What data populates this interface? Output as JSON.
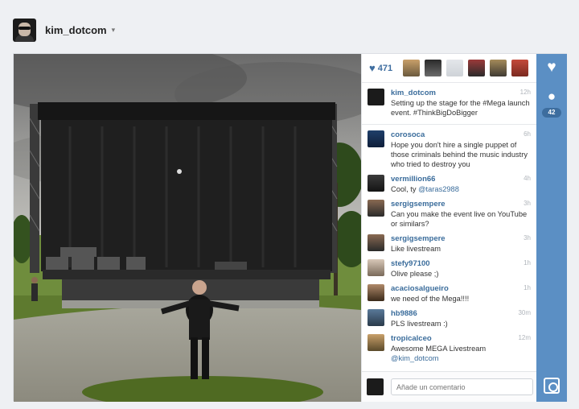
{
  "header": {
    "username": "kim_dotcom",
    "caret": "▾"
  },
  "likes": {
    "icon": "heart-icon",
    "count": "471"
  },
  "comments": [
    {
      "user": "kim_dotcom",
      "text": "Setting up the stage for the #Mega launch event. #ThinkBigDoBigger",
      "time": "12h"
    },
    {
      "user": "corosoca",
      "text": "Hope you don't hire a single puppet of those criminals behind the music industry who tried to destroy you",
      "time": "6h"
    },
    {
      "user": "vermillion66",
      "text": "Cool, ty ",
      "mention": "@taras2988",
      "time": "4h"
    },
    {
      "user": "sergigsempere",
      "text": "Can you make the event live on YouTube or similars?",
      "time": "3h"
    },
    {
      "user": "sergigsempere",
      "text": "Like livestream",
      "time": "3h"
    },
    {
      "user": "stefy97100",
      "text": "Olive please ;)",
      "time": "1h"
    },
    {
      "user": "acaciosalgueiro",
      "text": "we need of the Mega!!!!",
      "time": "1h"
    },
    {
      "user": "hb9886",
      "text": "PLS livestream :)",
      "time": "30m"
    },
    {
      "user": "tropicalceo",
      "text": "Awesome MEGA Livestream ",
      "mention": "@kim_dotcom",
      "time": "12m"
    }
  ],
  "add_comment": {
    "placeholder": "Añade un comentario"
  },
  "rail": {
    "like_icon": "heart-icon",
    "comment_icon": "speech-bubble-icon",
    "comment_count": "42",
    "instagram_icon": "instagram-icon"
  },
  "colors": {
    "accent": "#3a6c9b",
    "rail": "#5b8fc4"
  }
}
